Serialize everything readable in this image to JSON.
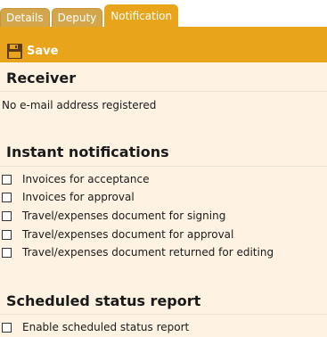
{
  "tabs": [
    {
      "label": "Details",
      "active": false
    },
    {
      "label": "Deputy",
      "active": false
    },
    {
      "label": "Notification",
      "active": true
    }
  ],
  "toolbar": {
    "save_label": "Save"
  },
  "receiver": {
    "title": "Receiver",
    "message": "No e-mail address registered"
  },
  "instant": {
    "title": "Instant notifications",
    "items": [
      {
        "label": "Invoices for acceptance",
        "checked": false
      },
      {
        "label": "Invoices for approval",
        "checked": false
      },
      {
        "label": "Travel/expenses document for signing",
        "checked": false
      },
      {
        "label": "Travel/expenses document for approval",
        "checked": false
      },
      {
        "label": "Travel/expenses document returned for editing",
        "checked": false
      }
    ]
  },
  "scheduled": {
    "title": "Scheduled status report",
    "items": [
      {
        "label": "Enable scheduled status report",
        "checked": false
      }
    ]
  },
  "colors": {
    "accent": "#e8a41b",
    "tab_inactive": "#d4a64c",
    "panel_bg": "#fef3e2",
    "save_icon": "#5a3a12"
  }
}
